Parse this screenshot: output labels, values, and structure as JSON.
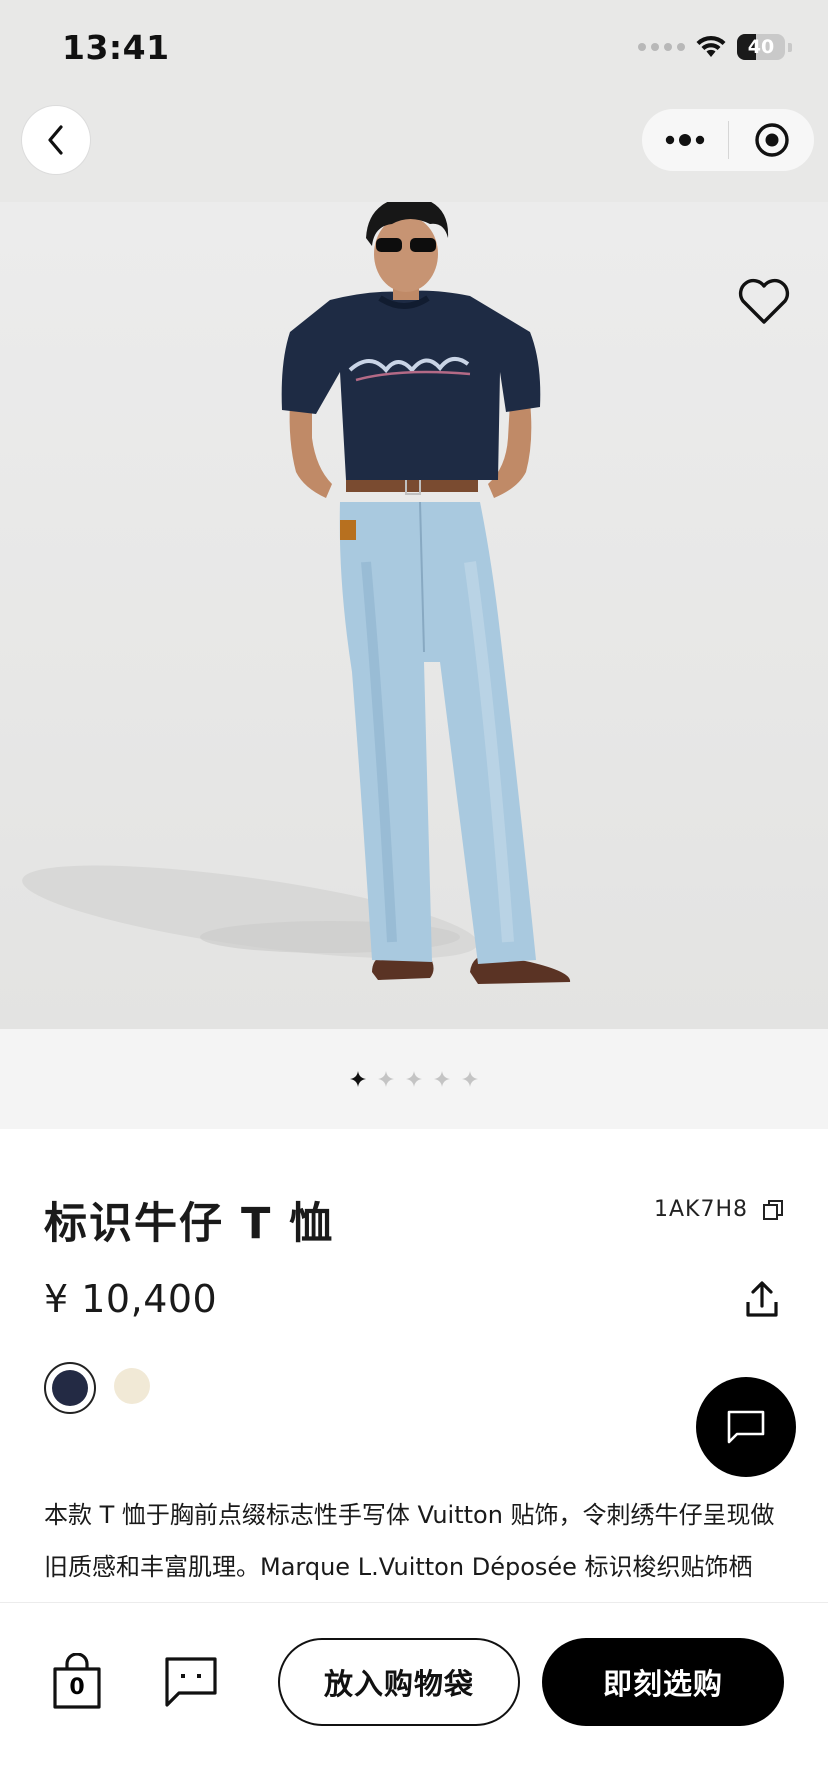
{
  "status_bar": {
    "time": "13:41",
    "battery_level": "40",
    "battery_fraction": 0.4
  },
  "nav": {
    "back_icon": "chevron-left-icon",
    "more_icon": "more-dots-icon",
    "target_icon": "target-icon"
  },
  "hero": {
    "wishlist_icon": "heart-icon",
    "image_count": 5,
    "current_image": 1
  },
  "product": {
    "title": "标识牛仔 T 恤",
    "sku": "1AK7H8",
    "price": "¥ 10,400",
    "colors": [
      {
        "name": "navy",
        "hex": "#232a44",
        "selected": true
      },
      {
        "name": "cream",
        "hex": "#f1e9d6",
        "selected": false
      }
    ],
    "description": "本款 T 恤于胸前点缀标志性手写体 Vuitton 贴饰，令刺绣牛仔呈现做旧质感和丰富肌理。Marque L.Vuitton Déposée 标识梭织贴饰栖"
  },
  "bottom_bar": {
    "bag_count": "0",
    "add_to_bag_label": "放入购物袋",
    "buy_now_label": "即刻选购"
  },
  "colors": {
    "accent": "#000000",
    "background_top": "#e8e8e7"
  }
}
